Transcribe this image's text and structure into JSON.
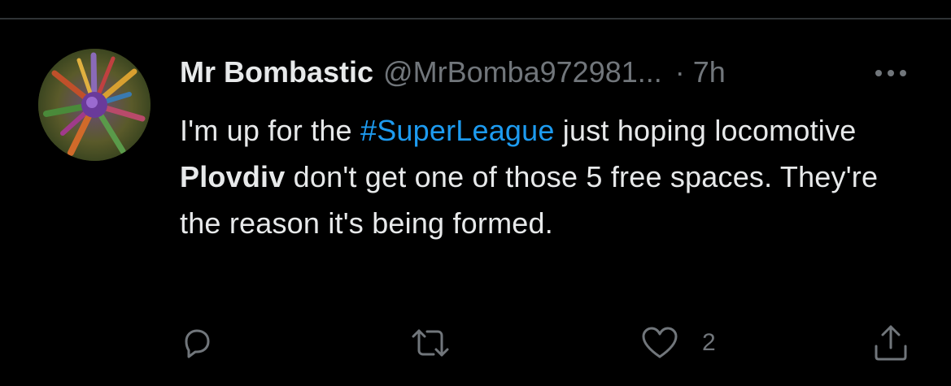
{
  "tweet": {
    "display_name": "Mr Bombastic",
    "handle": "@MrBomba972981...",
    "separator": "·",
    "time": "7h",
    "text": {
      "part1": "I'm up for the ",
      "hashtag": "#SuperLeague",
      "part2": " just hoping locomotive ",
      "bold": "Plovdiv",
      "part3": " don't get one of those 5 free spaces. They're the reason it's being formed."
    },
    "likes": "2"
  },
  "icons": {
    "more": "more-horizontal-icon",
    "reply": "reply-icon",
    "retweet": "retweet-icon",
    "like": "heart-icon",
    "share": "share-icon"
  },
  "colors": {
    "background": "#000000",
    "primary_text": "#e7e9ea",
    "secondary_text": "#71767b",
    "link": "#1d9bf0",
    "divider": "#2f3336"
  }
}
